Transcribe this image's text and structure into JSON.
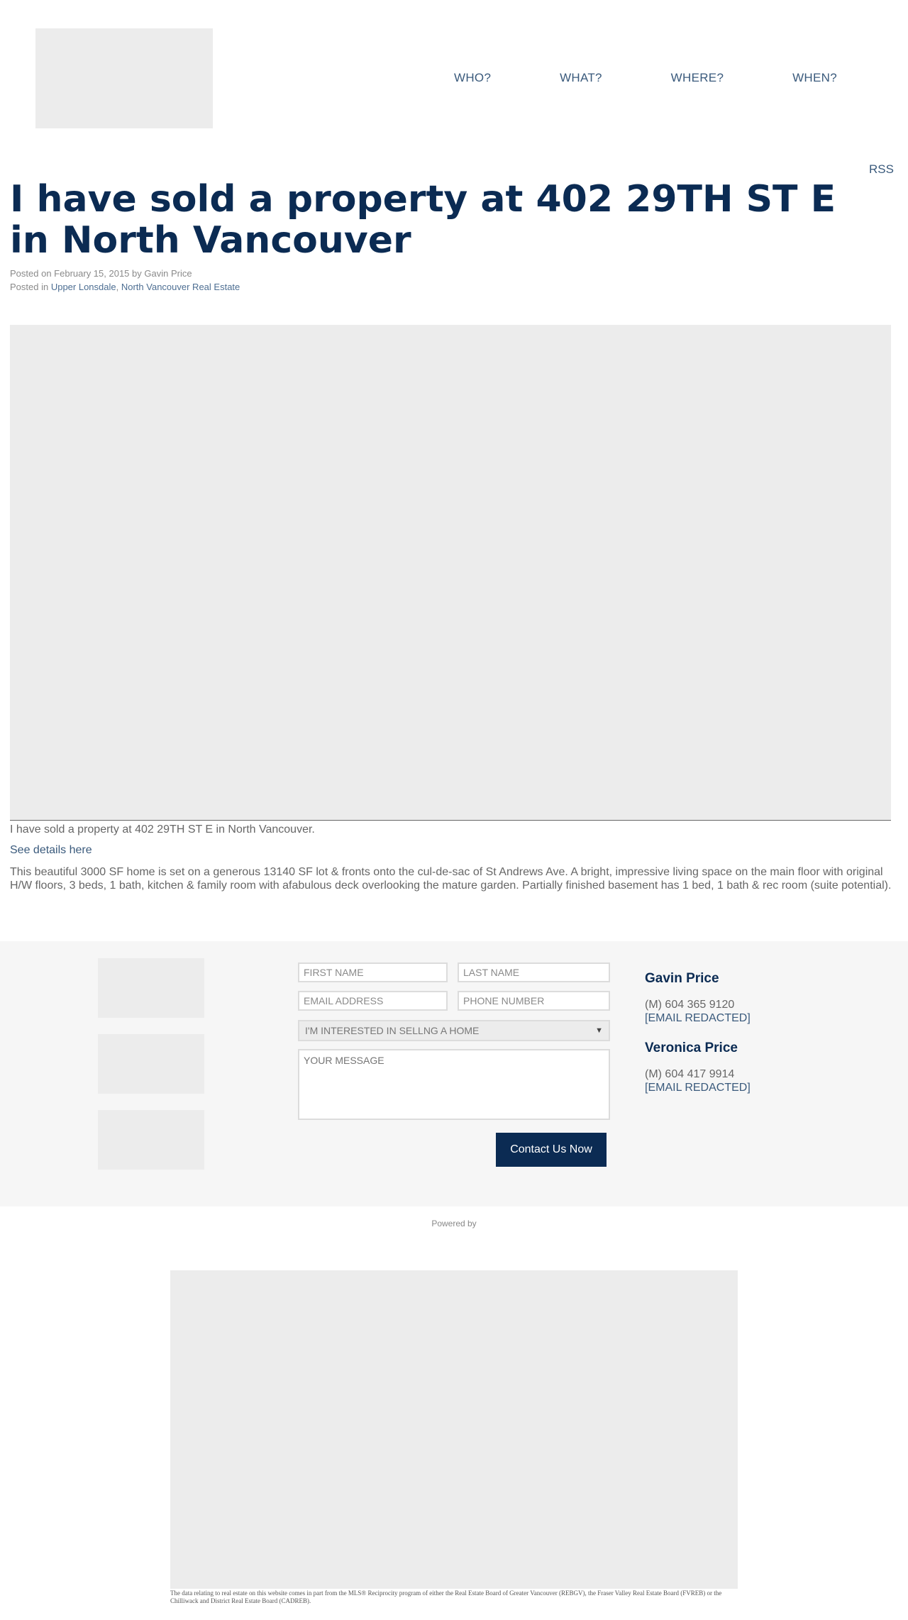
{
  "nav": {
    "items": [
      "WHO?",
      "WHAT?",
      "WHERE?",
      "WHEN?"
    ]
  },
  "rss_label": "RSS",
  "post": {
    "title": "I have sold a property at 402 29TH ST E in North Vancouver",
    "posted_on_prefix": "Posted on",
    "date": "February 15, 2015",
    "by_word": "by",
    "author": "Gavin Price",
    "posted_in_prefix": "Posted in",
    "categories": [
      "Upper Lonsdale",
      "North Vancouver Real Estate"
    ],
    "category_separator": ", ",
    "caption": "I have sold a property at 402 29TH ST E in North Vancouver.",
    "details_link": "See details here",
    "description": "This beautiful 3000 SF home is set on a generous 13140 SF lot & fronts onto the cul-de-sac of St Andrews Ave. A bright, impressive living space on the main floor with original H/W floors, 3 beds, 1 bath, kitchen & family room with afabulous deck overlooking the mature garden. Partially finished basement has 1 bed, 1 bath & rec room (suite potential)."
  },
  "contact_form": {
    "first_name_placeholder": "FIRST NAME",
    "last_name_placeholder": "LAST NAME",
    "email_placeholder": "EMAIL ADDRESS",
    "phone_placeholder": "PHONE NUMBER",
    "interest_selected": "I'M INTERESTED IN SELLNG A HOME",
    "message_placeholder": "YOUR MESSAGE",
    "submit_label": "Contact Us Now"
  },
  "agents": [
    {
      "name": "Gavin Price",
      "phone": "(M) 604 365 9120",
      "email": "[EMAIL REDACTED]"
    },
    {
      "name": "Veronica Price",
      "phone": "(M) 604 417 9914",
      "email": "[EMAIL REDACTED]"
    }
  ],
  "footer": {
    "powered_by": "Powered by",
    "disclaimer": "The data relating to real estate on this website comes in part from the MLS® Reciprocity program of either the Real Estate Board of Greater Vancouver (REBGV), the Fraser Valley Real Estate Board (FVREB) or the Chilliwack and District Real Estate Board (CADREB)."
  },
  "colors": {
    "brand_navy": "#0b2b53",
    "link_blue": "#3a5a7c",
    "placeholder_gray": "#ececec"
  }
}
